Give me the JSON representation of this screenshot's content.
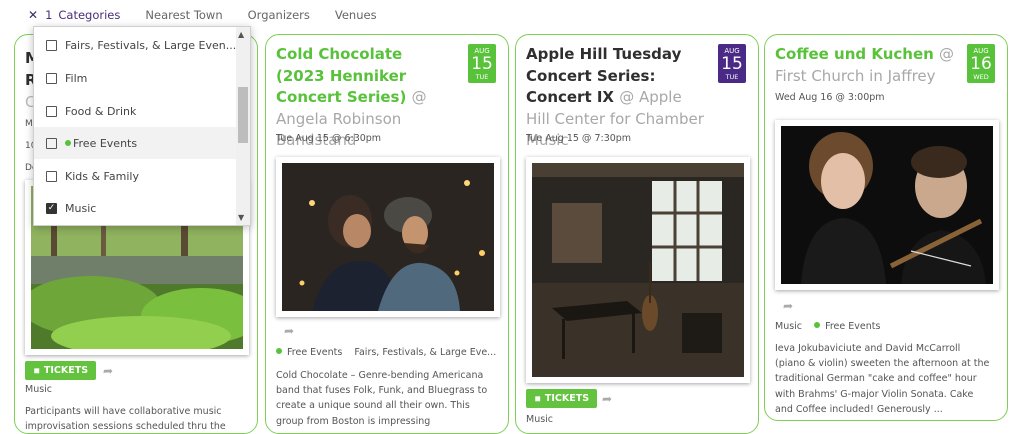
{
  "filters": {
    "count_label": "1",
    "categories_label": "Categories",
    "nearest_town_label": "Nearest Town",
    "organizers_label": "Organizers",
    "venues_label": "Venues"
  },
  "dropdown": {
    "items": [
      {
        "label": "Fairs, Festivals, & Large Even...",
        "checked": false
      },
      {
        "label": "Film",
        "checked": false
      },
      {
        "label": "Food & Drink",
        "checked": false
      },
      {
        "label": "Free Events",
        "checked": false
      },
      {
        "label": "Kids & Family",
        "checked": false
      },
      {
        "label": "Music",
        "checked": true
      }
    ]
  },
  "cards": [
    {
      "title_lines": [
        "M",
        "R"
      ],
      "venue_hint": "C",
      "meta_lines": [
        "M",
        "10",
        "De"
      ],
      "tickets_label": "TICKETS",
      "category": "Music",
      "description": "Participants will have collaborative music improvisation sessions scheduled thru the"
    },
    {
      "title": "Cold Chocolate (2023 Henniker Concert Series)",
      "venue": "@ Angela Robinson Bandstand",
      "date_month": "AUG",
      "date_day": "15",
      "date_dow": "TUE",
      "when": "Tue Aug 15 @ 6:30pm",
      "tag_free": "Free Events",
      "tag_other": "Fairs, Festivals, & Large Eve...",
      "description": "Cold Chocolate – Genre-bending Americana band that fuses Folk, Funk, and Bluegrass to create a unique sound all their own. This group from Boston is impressing"
    },
    {
      "title": "Apple Hill Tuesday Concert Series: Concert IX",
      "venue": "@ Apple Hill Center for Chamber Music",
      "date_month": "AUG",
      "date_day": "15",
      "date_dow": "TUE",
      "when": "Tue Aug 15 @ 7:30pm",
      "tickets_label": "TICKETS",
      "category": "Music"
    },
    {
      "title": "Coffee und Kuchen",
      "venue": "@ First Church in Jaffrey",
      "date_month": "AUG",
      "date_day": "16",
      "date_dow": "WED",
      "when": "Wed Aug 16 @ 3:00pm",
      "category": "Music",
      "tag_free": "Free Events",
      "description": "Ieva Jokubaviciute and David McCarroll (piano & violin) sweeten the afternoon at the traditional German \"cake and coffee\" hour with Brahms' G-major Violin Sonata. Cake and Coffee included! Generously ..."
    }
  ],
  "colors": {
    "accent_green": "#58c23a",
    "badge_purple": "#4a2a86",
    "border_green": "#7fcf57"
  },
  "icons": {
    "clear_filter": "close-icon",
    "share": "share-icon",
    "tickets": "tag-icon",
    "checkbox": "checkbox-icon"
  }
}
